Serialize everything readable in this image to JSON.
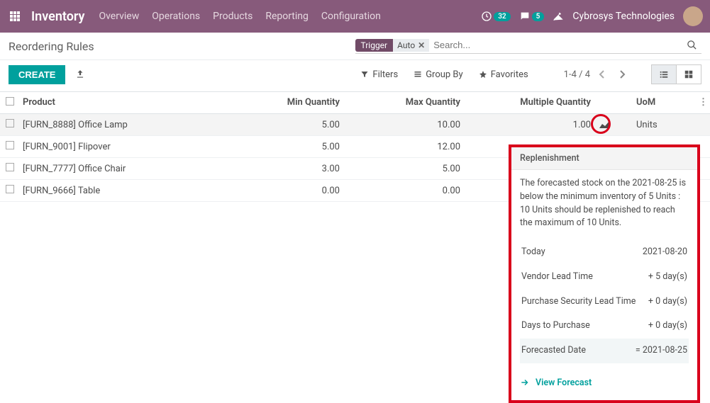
{
  "header": {
    "brand": "Inventory",
    "nav": [
      "Overview",
      "Operations",
      "Products",
      "Reporting",
      "Configuration"
    ],
    "clock_badge": "32",
    "chat_badge": "5",
    "user": "Cybrosys Technologies"
  },
  "breadcrumb": "Reordering Rules",
  "search": {
    "facet_label": "Trigger",
    "facet_value": "Auto",
    "placeholder": "Search..."
  },
  "toolbar": {
    "create": "CREATE",
    "filters": "Filters",
    "groupby": "Group By",
    "favorites": "Favorites",
    "pager": "1-4 / 4"
  },
  "columns": {
    "product": "Product",
    "min": "Min Quantity",
    "max": "Max Quantity",
    "multiple": "Multiple Quantity",
    "uom": "UoM"
  },
  "rows": [
    {
      "product": "[FURN_8888] Office Lamp",
      "min": "5.00",
      "max": "10.00",
      "multiple": "1.00",
      "uom": "Units",
      "show_forecast_icon": true
    },
    {
      "product": "[FURN_9001] Flipover",
      "min": "5.00",
      "max": "12.00",
      "multiple": "",
      "uom": ""
    },
    {
      "product": "[FURN_7777] Office Chair",
      "min": "3.00",
      "max": "5.00",
      "multiple": "",
      "uom": ""
    },
    {
      "product": "[FURN_9666] Table",
      "min": "0.00",
      "max": "0.00",
      "multiple": "",
      "uom": ""
    }
  ],
  "popover": {
    "title": "Replenishment",
    "desc": "The forecasted stock on the 2021-08-25 is below the minimum inventory of 5 Units : 10 Units should be replenished to reach the maximum of 10 Units.",
    "items": [
      {
        "label": "Today",
        "value": "2021-08-20"
      },
      {
        "label": "Vendor Lead Time",
        "value": "+ 5 day(s)"
      },
      {
        "label": "Purchase Security Lead Time",
        "value": "+ 0 day(s)"
      },
      {
        "label": "Days to Purchase",
        "value": "+ 0 day(s)"
      },
      {
        "label": "Forecasted Date",
        "value": "= 2021-08-25",
        "hl": true
      }
    ],
    "link": "View Forecast"
  }
}
